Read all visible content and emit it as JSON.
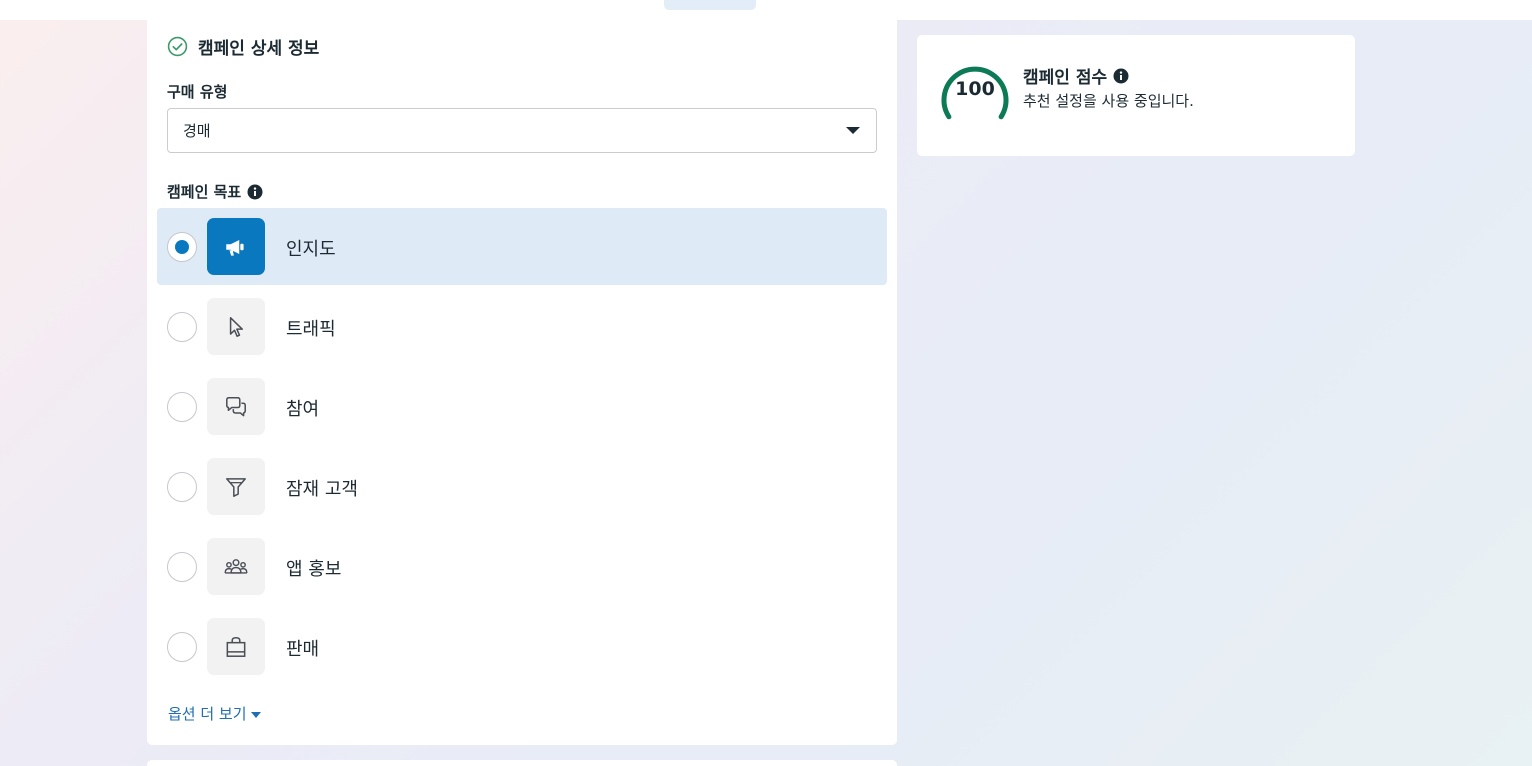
{
  "campaign_details": {
    "title": "캠페인 상세 정보",
    "buying_type": {
      "label": "구매 유형",
      "value": "경매"
    },
    "objective": {
      "label": "캠페인 목표",
      "options": [
        {
          "label": "인지도",
          "icon": "megaphone-icon",
          "selected": true
        },
        {
          "label": "트래픽",
          "icon": "cursor-icon",
          "selected": false
        },
        {
          "label": "참여",
          "icon": "chat-bubbles-icon",
          "selected": false
        },
        {
          "label": "잠재 고객",
          "icon": "funnel-icon",
          "selected": false
        },
        {
          "label": "앱 홍보",
          "icon": "people-group-icon",
          "selected": false
        },
        {
          "label": "판매",
          "icon": "shopping-bag-icon",
          "selected": false
        }
      ],
      "more_options": "옵션 더 보기"
    }
  },
  "campaign_score": {
    "value": "100",
    "title": "캠페인 점수",
    "subtitle": "추천 설정을 사용 중입니다."
  },
  "colors": {
    "accent_blue": "#0a78be",
    "link_blue": "#1f6fb2",
    "score_green": "#0b7a55",
    "selected_row_bg": "#deeaf6",
    "text_dark": "#1c2b33"
  }
}
